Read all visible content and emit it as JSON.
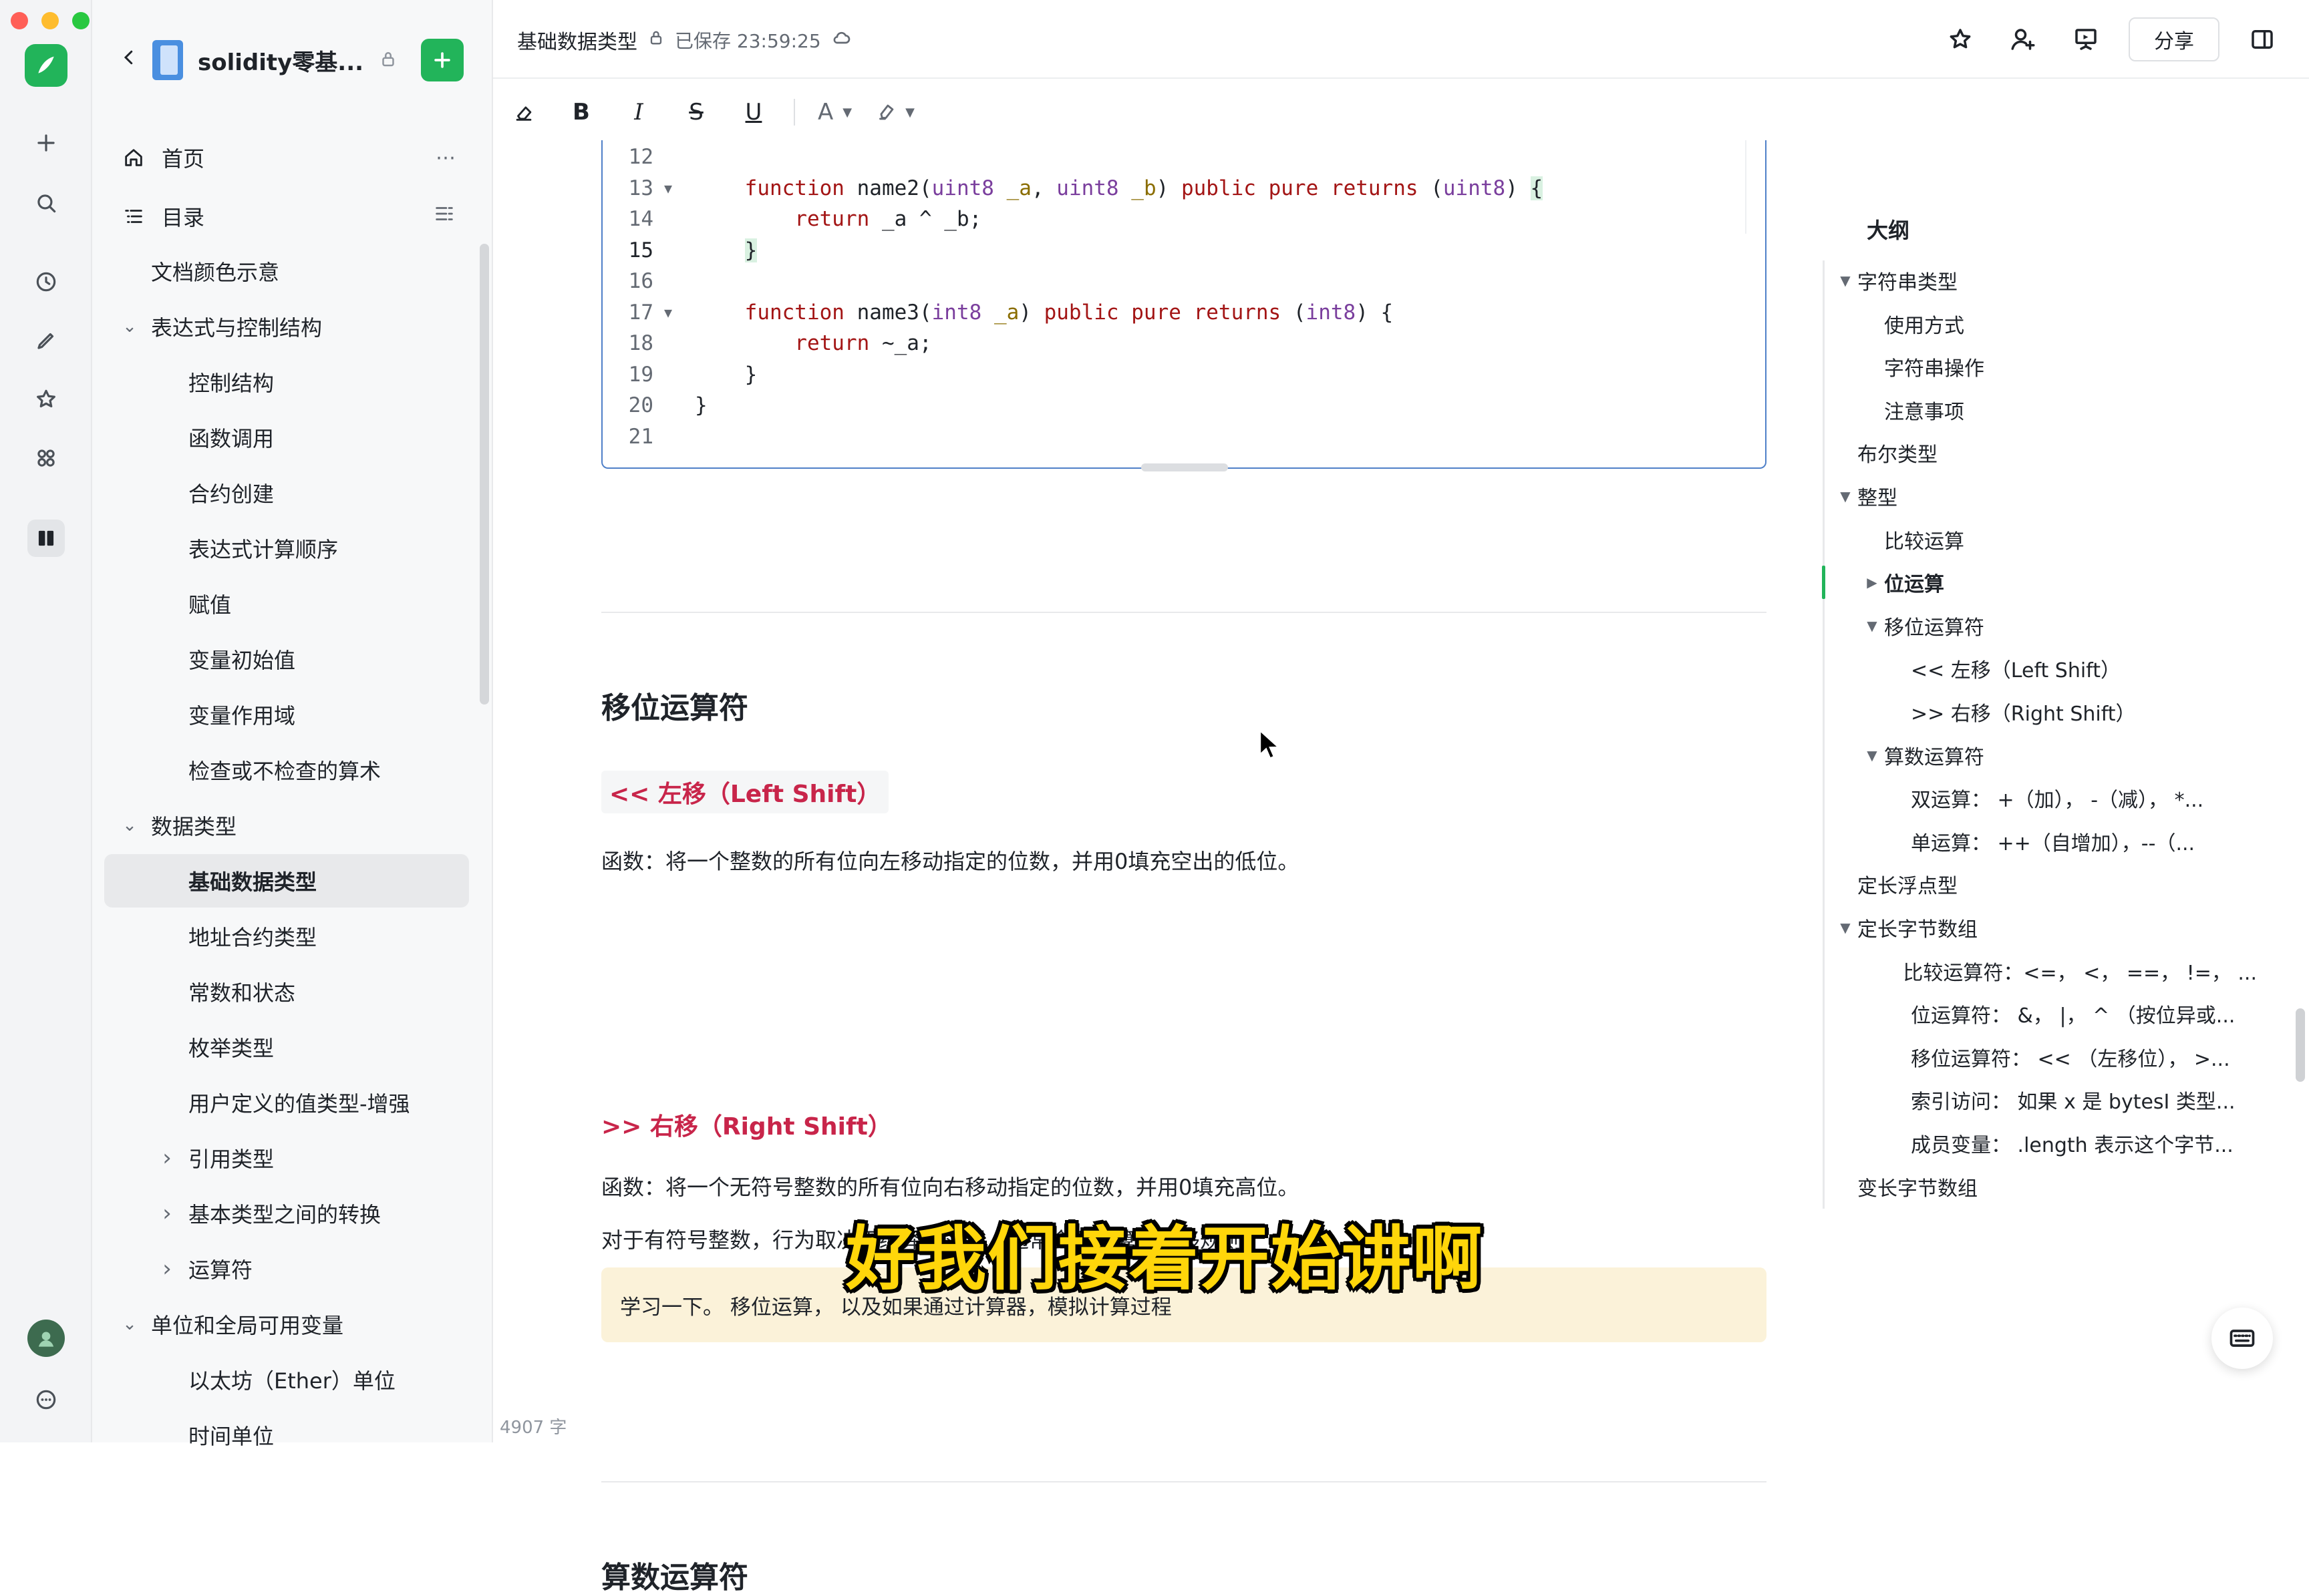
{
  "sidebar": {
    "title": "solidity零基...",
    "nav": [
      {
        "label": "首页"
      },
      {
        "label": "目录"
      }
    ],
    "tree": [
      {
        "label": "文档颜色示意",
        "level": 0
      },
      {
        "label": "表达式与控制结构",
        "level": 0,
        "expand": "open"
      },
      {
        "label": "控制结构",
        "level": 1
      },
      {
        "label": "函数调用",
        "level": 1
      },
      {
        "label": "合约创建",
        "level": 1
      },
      {
        "label": "表达式计算顺序",
        "level": 1
      },
      {
        "label": "赋值",
        "level": 1
      },
      {
        "label": "变量初始值",
        "level": 1
      },
      {
        "label": "变量作用域",
        "level": 1
      },
      {
        "label": "检查或不检查的算术",
        "level": 1
      },
      {
        "label": "数据类型",
        "level": 0,
        "expand": "open"
      },
      {
        "label": "基础数据类型",
        "level": 1,
        "active": true
      },
      {
        "label": "地址合约类型",
        "level": 1
      },
      {
        "label": "常数和状态",
        "level": 1
      },
      {
        "label": "枚举类型",
        "level": 1
      },
      {
        "label": "用户定义的值类型-增强",
        "level": 1
      },
      {
        "label": "引用类型",
        "level": 1,
        "expand": "closed"
      },
      {
        "label": "基本类型之间的转换",
        "level": 1,
        "expand": "closed"
      },
      {
        "label": "运算符",
        "level": 1,
        "expand": "closed"
      },
      {
        "label": "单位和全局可用变量",
        "level": 0,
        "expand": "open"
      },
      {
        "label": "以太坊（Ether）单位",
        "level": 1
      },
      {
        "label": "时间单位",
        "level": 1
      }
    ]
  },
  "header": {
    "doc_title": "基础数据类型",
    "saved_status": "已保存 23:59:25",
    "share_label": "分享"
  },
  "toolbar": {
    "color_label": "A"
  },
  "code": {
    "lines": [
      {
        "n": "12",
        "text": ""
      },
      {
        "n": "13",
        "fold": true,
        "parts": [
          [
            "kw",
            "function"
          ],
          [
            "",
            " name2("
          ],
          [
            "ty",
            "uint8"
          ],
          [
            "",
            " "
          ],
          [
            "pa",
            "_a"
          ],
          [
            "",
            ", "
          ],
          [
            "ty",
            "uint8"
          ],
          [
            "",
            " "
          ],
          [
            "pa",
            "_b"
          ],
          [
            "",
            ") "
          ],
          [
            "kw",
            "public pure returns"
          ],
          [
            "",
            " ("
          ],
          [
            "ty",
            "uint8"
          ],
          [
            "",
            ") "
          ],
          [
            "br",
            "{"
          ]
        ],
        "indent": "    "
      },
      {
        "n": "14",
        "parts": [
          [
            "kw",
            "return"
          ],
          [
            "",
            " _a ^ _b;"
          ]
        ],
        "indent": "        "
      },
      {
        "n": "15",
        "current": true,
        "parts": [
          [
            "br",
            "}"
          ]
        ],
        "indent": "    "
      },
      {
        "n": "16",
        "text": ""
      },
      {
        "n": "17",
        "fold": true,
        "parts": [
          [
            "kw",
            "function"
          ],
          [
            "",
            " name3("
          ],
          [
            "ty",
            "int8"
          ],
          [
            "",
            " "
          ],
          [
            "pa",
            "_a"
          ],
          [
            "",
            ") "
          ],
          [
            "kw",
            "public pure returns"
          ],
          [
            "",
            " ("
          ],
          [
            "ty",
            "int8"
          ],
          [
            "",
            ") {"
          ]
        ],
        "indent": "    "
      },
      {
        "n": "18",
        "parts": [
          [
            "kw",
            "return"
          ],
          [
            "",
            " ~_a;"
          ]
        ],
        "indent": "        "
      },
      {
        "n": "19",
        "parts": [
          [
            "",
            "}"
          ]
        ],
        "indent": "    "
      },
      {
        "n": "20",
        "parts": [
          [
            "",
            "}"
          ]
        ],
        "indent": ""
      },
      {
        "n": "21",
        "text": ""
      }
    ]
  },
  "doc": {
    "h2_shift": "移位运算符",
    "h3_left": "<< 左移（Left Shift）",
    "p_left": "函数：将一个整数的所有位向左移动指定的位数，并用0填充空出的低位。",
    "h3_right": ">> 右移（Right Shift）",
    "p_right1": "函数：将一个无符号整数的所有位向右移动指定的位数，并用0填充高位。",
    "p_right2": "对于有符号整数，行为取决于编译器实现，通常会遵循算术右移规则。",
    "callout": "学习一下。 移位运算， 以及如果通过计算器，模拟计算过程",
    "h2_arith": "算数运算符",
    "word_count": "4907 字"
  },
  "outline": {
    "title": "大纲",
    "items": [
      {
        "label": "字符串类型",
        "level": 0,
        "arrow": "open"
      },
      {
        "label": "使用方式",
        "level": 1
      },
      {
        "label": "字符串操作",
        "level": 1
      },
      {
        "label": "注意事项",
        "level": 1
      },
      {
        "label": "布尔类型",
        "level": 0
      },
      {
        "label": "整型",
        "level": 0,
        "arrow": "open"
      },
      {
        "label": "比较运算",
        "level": 1
      },
      {
        "label": "位运算",
        "level": 1,
        "arrow": "closed",
        "active": true
      },
      {
        "label": "移位运算符",
        "level": 1,
        "arrow": "open"
      },
      {
        "label": "<< 左移（Left Shift）",
        "level": 2
      },
      {
        "label": ">> 右移（Right Shift）",
        "level": 2
      },
      {
        "label": "算数运算符",
        "level": 1,
        "arrow": "open"
      },
      {
        "label": "双运算： +（加）， -（减）， *...",
        "level": 2
      },
      {
        "label": "单运算： ++（自增加），--（...",
        "level": 2
      },
      {
        "label": "定长浮点型",
        "level": 0
      },
      {
        "label": "定长字节数组",
        "level": 0,
        "arrow": "open"
      },
      {
        "label": "比较运算符：<=， <， ==， !=， ...",
        "level": 2
      },
      {
        "label": "位运算符： &， |， ^ （按位异或...",
        "level": 2
      },
      {
        "label": "移位运算符： << （左移位）， >...",
        "level": 2
      },
      {
        "label": "索引访问： 如果 x 是 bytesI 类型...",
        "level": 2
      },
      {
        "label": "成员变量： .length 表示这个字节...",
        "level": 2
      },
      {
        "label": "变长字节数组",
        "level": 0
      }
    ]
  },
  "subtitle": "好我们接着开始讲啊",
  "colors": {
    "accent_green": "#22b45a",
    "heading_red": "#c8254a",
    "callout_bg": "#fbf2d9",
    "code_border": "#4f80c8",
    "subtitle_yellow": "#ffd60a"
  }
}
